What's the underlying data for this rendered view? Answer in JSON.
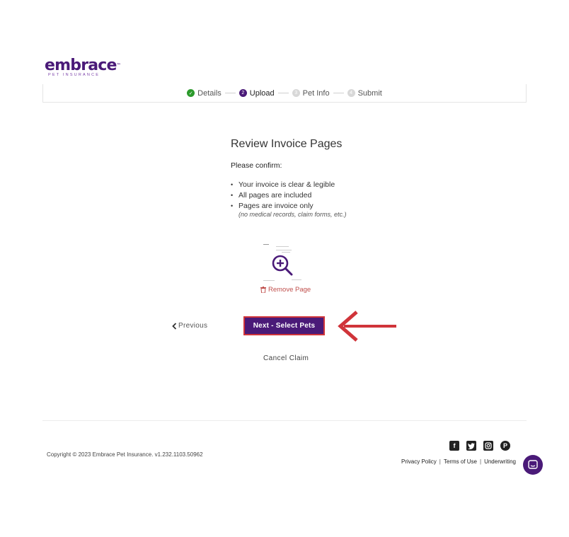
{
  "brand": {
    "name": "embrace",
    "tagline": "PET INSURANCE",
    "tm": "™",
    "color": "#4a1a78"
  },
  "steps": [
    {
      "label": "Details",
      "state": "done",
      "icon": "check-icon"
    },
    {
      "label": "Upload",
      "state": "active",
      "number": "2"
    },
    {
      "label": "Pet Info",
      "state": "todo",
      "number": "3"
    },
    {
      "label": "Submit",
      "state": "todo",
      "number": "4"
    }
  ],
  "main": {
    "title": "Review Invoice Pages",
    "confirm": "Please confirm:",
    "bullets": [
      "Your invoice is clear & legible",
      "All pages are included",
      "Pages are invoice only"
    ],
    "note": "(no medical records, claim forms, etc.)",
    "remove_page": "Remove Page"
  },
  "nav": {
    "previous": "Previous",
    "next": "Next - Select Pets",
    "cancel": "Cancel Claim"
  },
  "footer": {
    "copyright": "Copyright © 2023   Embrace Pet Insurance. v1.232.1103.50962",
    "links": [
      "Privacy Policy",
      "Terms of Use",
      "Underwriting"
    ],
    "socials": [
      "facebook-icon",
      "twitter-icon",
      "instagram-icon",
      "pinterest-icon"
    ]
  },
  "colors": {
    "accent": "#4a1a78",
    "annotation_red": "#d0343a",
    "success": "#2c9a2c",
    "danger": "#c0504d"
  }
}
